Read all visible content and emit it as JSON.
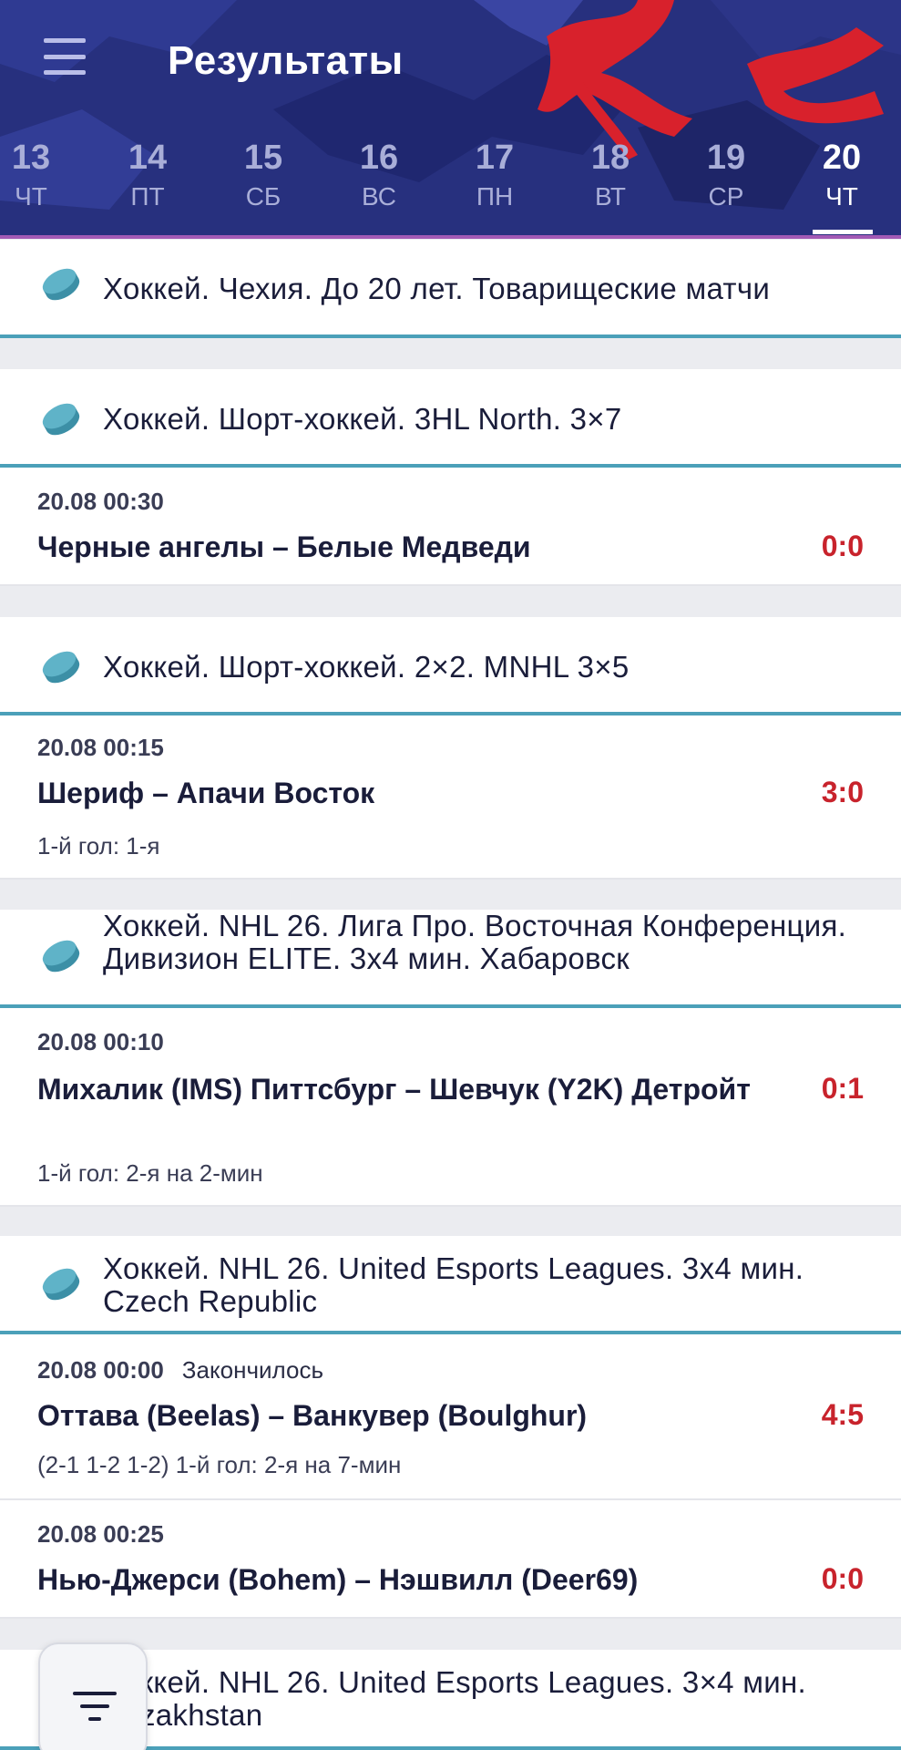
{
  "header": {
    "title": "Результаты",
    "days": [
      {
        "num": "13",
        "wd": "ЧТ",
        "active": false
      },
      {
        "num": "14",
        "wd": "ПТ",
        "active": false
      },
      {
        "num": "15",
        "wd": "СБ",
        "active": false
      },
      {
        "num": "16",
        "wd": "ВС",
        "active": false
      },
      {
        "num": "17",
        "wd": "ПН",
        "active": false
      },
      {
        "num": "18",
        "wd": "ВТ",
        "active": false
      },
      {
        "num": "19",
        "wd": "СР",
        "active": false
      },
      {
        "num": "20",
        "wd": "ЧТ",
        "active": true
      }
    ]
  },
  "leagues": [
    {
      "name": "Хоккей. Чехия. До 20 лет. Товарищеские матчи"
    },
    {
      "name": "Хоккей. Шорт-хоккей. 3HL North. 3×7"
    },
    {
      "name": "Хоккей. Шорт-хоккей. 2×2. MNHL 3×5"
    },
    {
      "name": "Хоккей. NHL 26. Лига Про. Восточная Конференция. Дивизион ELITE. 3x4 мин. Хабаровск"
    },
    {
      "name": "Хоккей. NHL 26. United Esports Leagues. 3x4 мин. Czech Republic"
    },
    {
      "name": "Хоккей. NHL 26. United Esports Leagues. 3×4 мин. Kazakhstan"
    }
  ],
  "matches": [
    {
      "time": "20.08 00:30",
      "status": "",
      "teams": "Черные ангелы – Белые Медведи",
      "score": "0:0",
      "info": ""
    },
    {
      "time": "20.08 00:15",
      "status": "",
      "teams": "Шериф – Апачи Восток",
      "score": "3:0",
      "info": "1-й гол: 1-я"
    },
    {
      "time": "20.08 00:10",
      "status": "",
      "teams": "Михалик (IMS) Питтсбург – Шевчук (Y2K) Детройт",
      "score": "0:1",
      "info": "1-й гол: 2-я на 2-мин"
    },
    {
      "time": "20.08 00:00",
      "status": "Закончилось",
      "teams": "Оттава (Beelas) – Ванкувер (Boulghur)",
      "score": "4:5",
      "info": "(2-1 1-2 1-2) 1-й гол: 2-я на 7-мин"
    },
    {
      "time": "20.08 00:25",
      "status": "",
      "teams": "Нью-Джерси (Bohem) – Нэшвилл (Deer69)",
      "score": "0:0",
      "info": ""
    }
  ],
  "colors": {
    "header_bg": "#27307e",
    "accent_line": "#4ba0b9",
    "score": "#c8232c",
    "brush_red": "#d8212c"
  }
}
